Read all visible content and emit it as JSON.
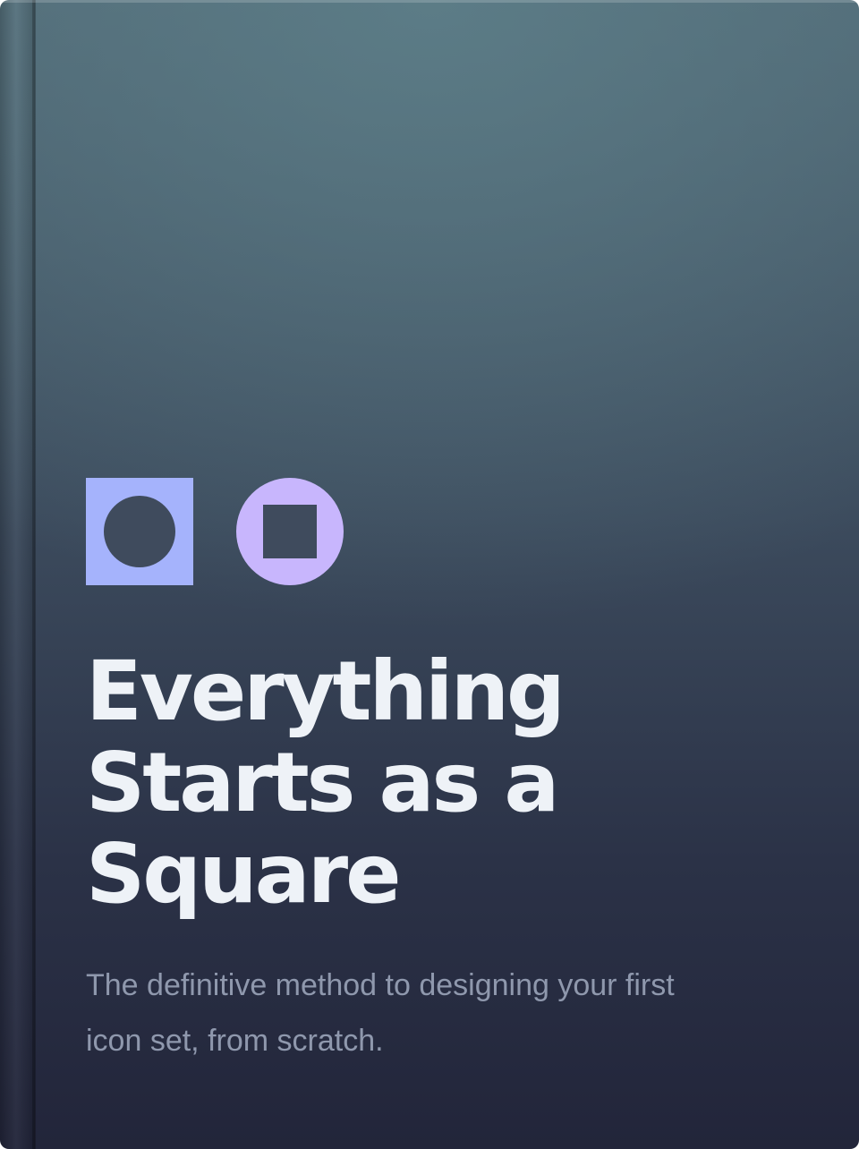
{
  "book": {
    "title_lines": [
      "Everything",
      "Starts as a",
      "Square"
    ],
    "subtitle_lines": [
      "The definitive method to designing your first",
      "icon set, from scratch."
    ]
  },
  "logo": {
    "square_icon": "square-with-circle-icon",
    "circle_icon": "circle-with-square-icon"
  },
  "colors": {
    "square_fill": "#a5b3fc",
    "circle_fill": "#c8b6fd",
    "inner_shape": "#3f4b5d",
    "title": "#eef2f7",
    "subtitle": "#8f98ad"
  }
}
